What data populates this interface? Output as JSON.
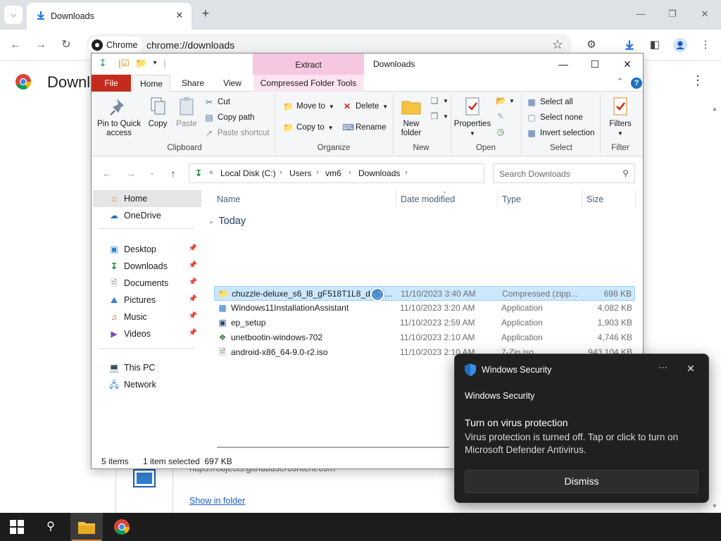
{
  "chrome": {
    "tab_title": "Downloads",
    "omnibox_chip": "Chrome",
    "url": "chrome://downloads",
    "page_title": "Downloads",
    "download_url": "https://objects.githubusercontent.com",
    "show_in_folder": "Show in folder"
  },
  "explorer": {
    "title": "Downloads",
    "contextual_tab": "Extract",
    "tabs": [
      "File",
      "Home",
      "Share",
      "View",
      "Compressed Folder Tools"
    ],
    "ribbon": {
      "clipboard": {
        "group": "Clipboard",
        "pin": "Pin to Quick access",
        "copy": "Copy",
        "paste": "Paste",
        "cut": "Cut",
        "copy_path": "Copy path",
        "paste_shortcut": "Paste shortcut"
      },
      "organize": {
        "group": "Organize",
        "move_to": "Move to",
        "copy_to": "Copy to",
        "delete": "Delete",
        "rename": "Rename"
      },
      "new": {
        "group": "New",
        "new_folder": "New folder"
      },
      "open": {
        "group": "Open",
        "properties": "Properties"
      },
      "select": {
        "group": "Select",
        "select_all": "Select all",
        "select_none": "Select none",
        "invert": "Invert selection"
      },
      "filter": {
        "group": "Filter",
        "filters": "Filters"
      }
    },
    "address": {
      "crumbs": [
        "Local Disk (C:)",
        "Users",
        "vm6",
        "Downloads"
      ],
      "search_placeholder": "Search Downloads"
    },
    "nav": {
      "home": "Home",
      "onedrive": "OneDrive",
      "quick": [
        "Desktop",
        "Downloads",
        "Documents",
        "Pictures",
        "Music",
        "Videos"
      ],
      "this_pc": "This PC",
      "network": "Network"
    },
    "columns": {
      "name": "Name",
      "date": "Date modified",
      "type": "Type",
      "size": "Size"
    },
    "group_label": "Today",
    "files": [
      {
        "name": "chuzzle-deluxe_s6_l8_gF518T1L8_d257804...",
        "date": "11/10/2023 3:40 AM",
        "type": "Compressed (zipp...",
        "size": "698 KB",
        "icon": "zip-folder-icon"
      },
      {
        "name": "Windows11InstallationAssistant",
        "date": "11/10/2023 3:20 AM",
        "type": "Application",
        "size": "4,082 KB",
        "icon": "windows-logo-icon"
      },
      {
        "name": "ep_setup",
        "date": "11/10/2023 2:59 AM",
        "type": "Application",
        "size": "1,903 KB",
        "icon": "app-window-icon"
      },
      {
        "name": "unetbootin-windows-702",
        "date": "11/10/2023 2:10 AM",
        "type": "Application",
        "size": "4,746 KB",
        "icon": "unetbootin-icon"
      },
      {
        "name": "android-x86_64-9.0-r2.iso",
        "date": "11/10/2023 2:10 AM",
        "type": "7-Zip.iso",
        "size": "943,104 KB",
        "icon": "iso-file-icon"
      }
    ],
    "status": {
      "items": "5 items",
      "selected": "1 item selected  697 KB"
    }
  },
  "toast": {
    "app": "Windows Security",
    "source": "Windows Security",
    "title": "Turn on virus protection",
    "body": "Virus protection is turned off. Tap or click to turn on Microsoft Defender Antivirus.",
    "dismiss": "Dismiss"
  },
  "colors": {
    "file_tab": "#c42b1c",
    "contextual_band": "#f7c6e1",
    "selection": "#cce8ff",
    "toast_bg": "#202020",
    "taskbar_bg": "#1c1c1c"
  }
}
